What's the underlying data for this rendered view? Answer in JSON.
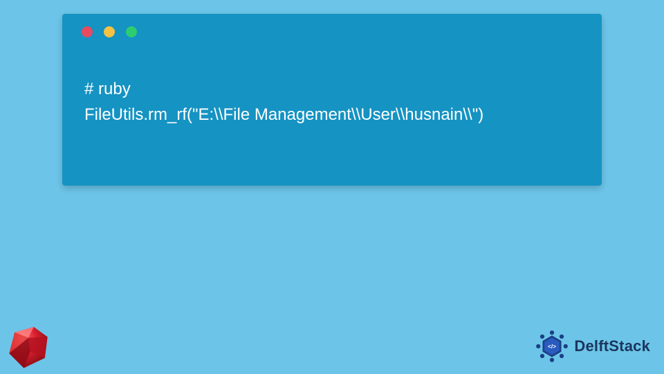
{
  "code": {
    "line1": "# ruby",
    "line2": "FileUtils.rm_rf(\"E:\\\\File Management\\\\User\\\\husnain\\\\\")"
  },
  "brand": {
    "name": "DelftStack"
  },
  "colors": {
    "page_bg": "#6cc5e8",
    "panel_bg": "#1593c3",
    "dot_red": "#e84a5f",
    "dot_yellow": "#f6c244",
    "dot_green": "#2ecc71",
    "brand_text": "#1b355e"
  }
}
